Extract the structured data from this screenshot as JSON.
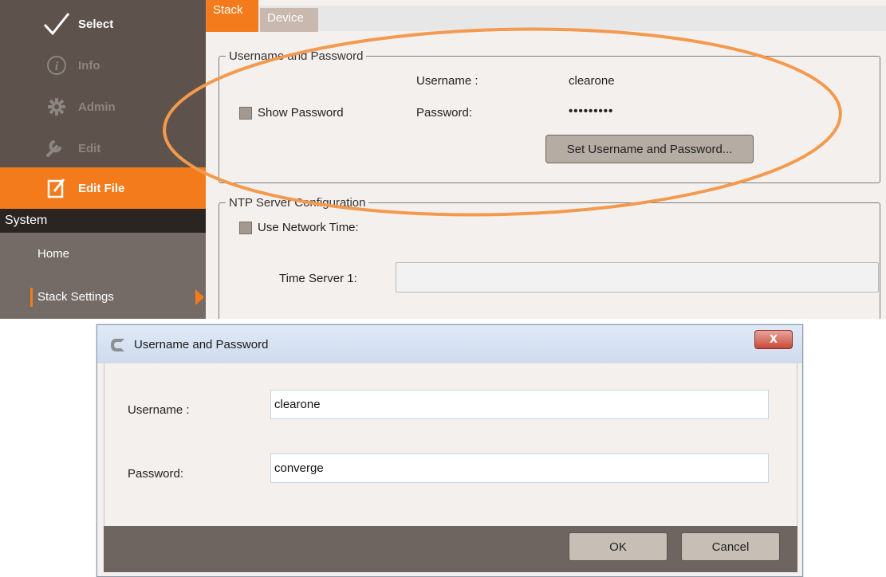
{
  "sidebar": {
    "items": [
      {
        "label": "Select",
        "icon": "checkmark-icon"
      },
      {
        "label": "Info",
        "icon": "info-icon"
      },
      {
        "label": "Admin",
        "icon": "gear-icon"
      },
      {
        "label": "Edit",
        "icon": "wrench-icon"
      },
      {
        "label": "Edit File",
        "icon": "edit-file-icon"
      }
    ],
    "section_title": "System",
    "sub_items": [
      {
        "label": "Home"
      },
      {
        "label": "Stack Settings"
      }
    ]
  },
  "tabs": [
    {
      "label": "Stack"
    },
    {
      "label": "Device"
    }
  ],
  "credentials_group": {
    "legend": "Username and Password",
    "username_label": "Username :",
    "username_value": "clearone",
    "show_password_label": "Show Password",
    "password_label": "Password:",
    "password_value": "•••••••••",
    "set_button": "Set Username and Password..."
  },
  "ntp_group": {
    "legend": "NTP Server Configuration",
    "use_network_time_label": "Use Network Time:",
    "time_server_label": "Time Server 1:",
    "time_server_value": ""
  },
  "dialog": {
    "title": "Username and Password",
    "close_label": "X",
    "username_label": "Username :",
    "username_value": "clearone",
    "password_label": "Password:",
    "password_value": "converge",
    "ok_button": "OK",
    "cancel_button": "Cancel"
  },
  "colors": {
    "accent": "#f37b1b",
    "sidebar": "#5d534c",
    "highlight_ellipse": "#f39a4e"
  }
}
